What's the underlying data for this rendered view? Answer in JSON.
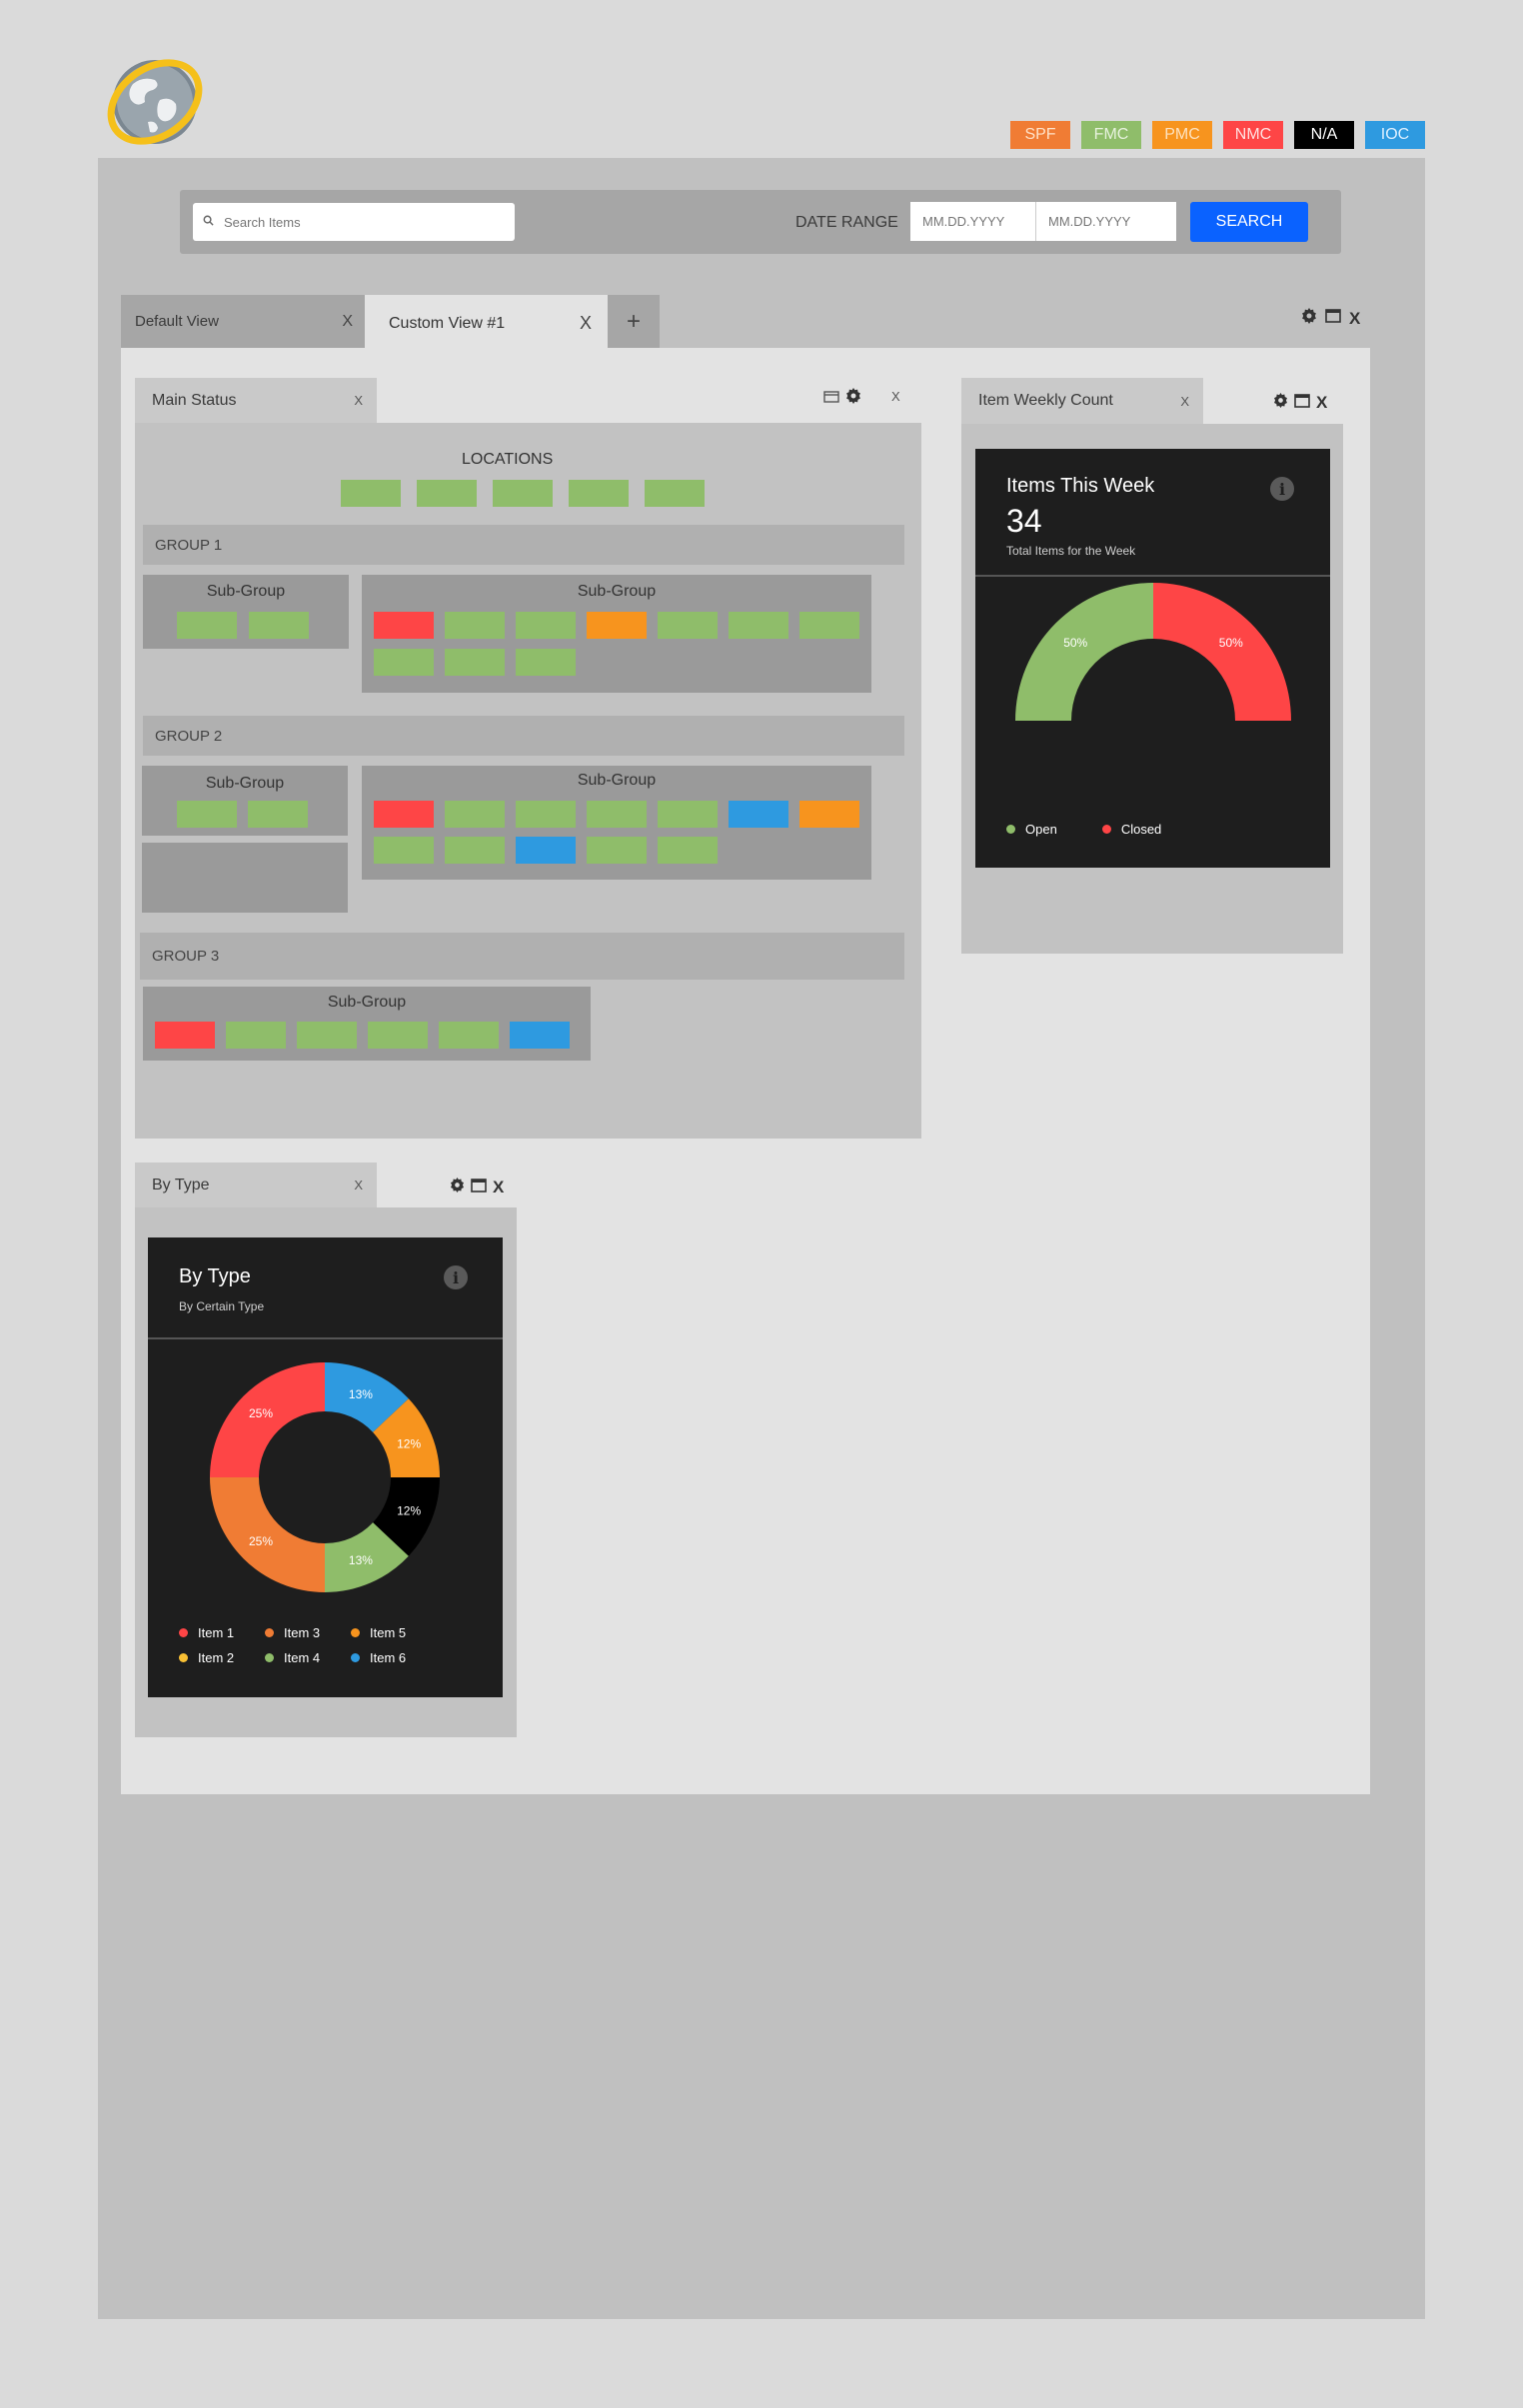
{
  "status_legend": [
    {
      "label": "SPF",
      "bg": "#f07c34",
      "fg": "#ffe2c8"
    },
    {
      "label": "FMC",
      "bg": "#8fbd6a",
      "fg": "#e7f2de"
    },
    {
      "label": "PMC",
      "bg": "#f7941e",
      "fg": "#fde2bf"
    },
    {
      "label": "NMC",
      "bg": "#fe4546",
      "fg": "#ffe0e0"
    },
    {
      "label": "N/A",
      "bg": "#000000",
      "fg": "#ffffff"
    },
    {
      "label": "IOC",
      "bg": "#2e9ae0",
      "fg": "#dcefff"
    }
  ],
  "search": {
    "placeholder": "Search Items",
    "date_range_label": "DATE RANGE",
    "date_from_placeholder": "MM.DD.YYYY",
    "date_to_placeholder": "MM.DD.YYYY",
    "button_label": "SEARCH"
  },
  "tabs": {
    "default": {
      "label": "Default View",
      "close": "X"
    },
    "custom": {
      "label": "Custom View #1",
      "close": "X"
    },
    "add": "+",
    "close_all": "X"
  },
  "main_status": {
    "title": "Main Status",
    "close": "X",
    "locations_label": "LOCATIONS",
    "group1": {
      "label": "GROUP 1",
      "sub_a": "Sub-Group",
      "sub_b": "Sub-Group"
    },
    "group2": {
      "label": "GROUP 2",
      "sub_a": "Sub-Group",
      "sub_b": "Sub-Group"
    },
    "group3": {
      "label": "GROUP 3",
      "sub_a": "Sub-Group"
    }
  },
  "weekly": {
    "tab_title": "Item Weekly Count",
    "close": "X",
    "ctrl_close": "X",
    "card_title": "Items This Week",
    "count": "34",
    "subtitle": "Total  Items for the Week",
    "info": "i",
    "chart_data": {
      "type": "pie",
      "categories": [
        "Open",
        "Closed"
      ],
      "values": [
        50,
        50
      ],
      "labels": [
        "50%",
        "50%"
      ],
      "colors": [
        "#8fbd6a",
        "#fe4546"
      ]
    }
  },
  "by_type": {
    "tab_title": "By Type",
    "close": "X",
    "ctrl_close": "X",
    "card_title": "By Type",
    "subtitle": "By Certain Type",
    "info": "i",
    "legend": [
      {
        "label": "Item 1",
        "color": "#fe4546"
      },
      {
        "label": "Item 3",
        "color": "#f07c34"
      },
      {
        "label": "Item 5",
        "color": "#f7941e"
      },
      {
        "label": "Item 2",
        "color": "#f9c034"
      },
      {
        "label": "Item 4",
        "color": "#8fbd6a"
      },
      {
        "label": "Item 6",
        "color": "#2e9ae0"
      }
    ],
    "chart_data": {
      "type": "pie",
      "categories": [
        "Item 6",
        "Item 5",
        "N/A",
        "Item 4",
        "Item 3",
        "Item 1"
      ],
      "values": [
        13,
        12,
        12,
        13,
        25,
        25
      ],
      "labels": [
        "13%",
        "12%",
        "12%",
        "13%",
        "25%",
        "25%"
      ],
      "colors": [
        "#2e9ae0",
        "#f7941e",
        "#000000",
        "#8fbd6a",
        "#f07c34",
        "#fe4546"
      ]
    }
  }
}
